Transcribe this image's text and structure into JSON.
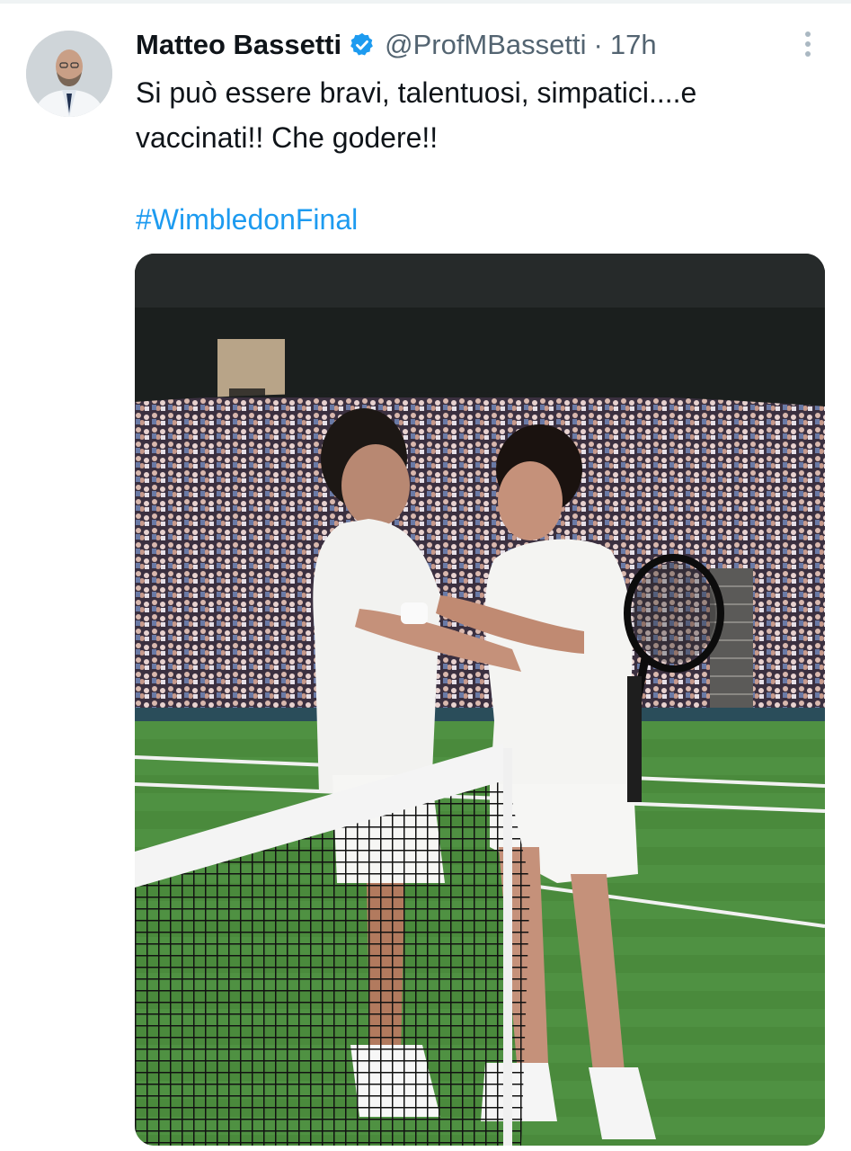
{
  "tweet": {
    "author_name": "Matteo Bassetti",
    "handle": "@ProfMBassetti",
    "separator": "·",
    "time": "17h",
    "text_line1": "Si può essere bravi, talentuosi, simpatici....e",
    "text_line2": "vaccinati!! Che godere!!",
    "hashtag": "#WimbledonFinal"
  },
  "icons": {
    "verified": "verified-badge-icon",
    "more": "more-vertical-icon"
  },
  "colors": {
    "accent": "#1d9bf0",
    "text": "#0f1419",
    "muted": "#536471",
    "court_green": "#4a8a3c"
  }
}
